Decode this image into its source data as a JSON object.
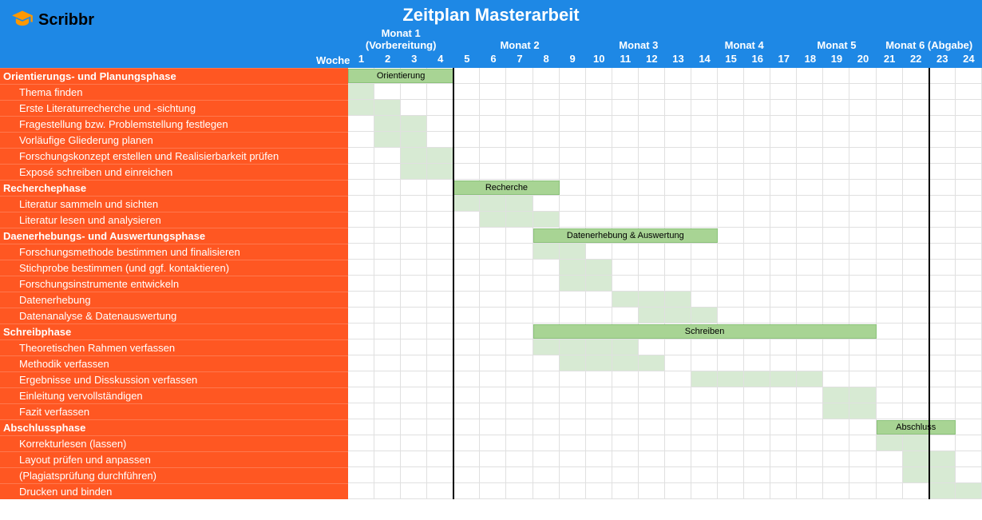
{
  "header": {
    "logo_text": "Scribbr",
    "title": "Zeitplan Masterarbeit",
    "week_label": "Woche",
    "months": [
      {
        "label": "Monat 1 (Vorbereitung)",
        "weeks": [
          1,
          2,
          3,
          4
        ]
      },
      {
        "label": "Monat 2",
        "weeks": [
          5,
          6,
          7,
          8,
          9
        ]
      },
      {
        "label": "Monat 3",
        "weeks": [
          10,
          11,
          12,
          13
        ]
      },
      {
        "label": "Monat 4",
        "weeks": [
          14,
          15,
          16,
          17
        ]
      },
      {
        "label": "Monat 5",
        "weeks": [
          18,
          19,
          20
        ]
      },
      {
        "label": "Monat 6 (Abgabe)",
        "weeks": [
          21,
          22,
          23,
          24
        ]
      }
    ]
  },
  "chart_data": {
    "type": "bar",
    "title": "Zeitplan Masterarbeit",
    "xlabel": "Woche",
    "x": [
      1,
      2,
      3,
      4,
      5,
      6,
      7,
      8,
      9,
      10,
      11,
      12,
      13,
      14,
      15,
      16,
      17,
      18,
      19,
      20,
      21,
      22,
      23,
      24
    ],
    "milestones": [
      4,
      22
    ],
    "phases": [
      {
        "name": "Orientierungs- und Planungsphase",
        "bar_label": "Orientierung",
        "start": 1,
        "end": 5,
        "tasks": [
          {
            "name": "Thema finden",
            "start": 1,
            "end": 2
          },
          {
            "name": "Erste Literaturrecherche und -sichtung",
            "start": 1,
            "end": 3
          },
          {
            "name": "Fragestellung bzw. Problemstellung festlegen",
            "start": 2,
            "end": 4
          },
          {
            "name": "Vorläufige Gliederung planen",
            "start": 2,
            "end": 4
          },
          {
            "name": "Forschungskonzept erstellen und Realisierbarkeit prüfen",
            "start": 3,
            "end": 5
          },
          {
            "name": "Exposé schreiben und einreichen",
            "start": 3,
            "end": 5
          }
        ]
      },
      {
        "name": "Recherchephase",
        "bar_label": "Recherche",
        "start": 5,
        "end": 9,
        "tasks": [
          {
            "name": "Literatur sammeln und sichten",
            "start": 5,
            "end": 8
          },
          {
            "name": "Literatur lesen und analysieren",
            "start": 6,
            "end": 9
          }
        ]
      },
      {
        "name": "Daenerhebungs- und Auswertungsphase",
        "bar_label": "Datenerhebung & Auswertung",
        "start": 8,
        "end": 15,
        "tasks": [
          {
            "name": "Forschungsmethode bestimmen und finalisieren",
            "start": 8,
            "end": 10
          },
          {
            "name": "Stichprobe bestimmen (und ggf. kontaktieren)",
            "start": 9,
            "end": 11
          },
          {
            "name": "Forschungsinstrumente entwickeln",
            "start": 9,
            "end": 11
          },
          {
            "name": "Datenerhebung",
            "start": 11,
            "end": 14
          },
          {
            "name": "Datenanalyse & Datenauswertung",
            "start": 12,
            "end": 15
          }
        ]
      },
      {
        "name": "Schreibphase",
        "bar_label": "Schreiben",
        "start": 8,
        "end": 21,
        "tasks": [
          {
            "name": "Theoretischen Rahmen verfassen",
            "start": 8,
            "end": 12
          },
          {
            "name": "Methodik verfassen",
            "start": 9,
            "end": 13
          },
          {
            "name": "Ergebnisse und Disskussion verfassen",
            "start": 14,
            "end": 19
          },
          {
            "name": "Einleitung vervollständigen",
            "start": 19,
            "end": 21
          },
          {
            "name": "Fazit verfassen",
            "start": 19,
            "end": 21
          }
        ]
      },
      {
        "name": "Abschlussphase",
        "bar_label": "Abschluss",
        "start": 21,
        "end": 24,
        "tasks": [
          {
            "name": "Korrekturlesen (lassen)",
            "start": 21,
            "end": 23
          },
          {
            "name": "Layout prüfen und anpassen",
            "start": 22,
            "end": 24
          },
          {
            "name": "(Plagiatsprüfung durchführen)",
            "start": 22,
            "end": 24
          },
          {
            "name": "Drucken und binden",
            "start": 23,
            "end": 25
          }
        ]
      }
    ]
  }
}
